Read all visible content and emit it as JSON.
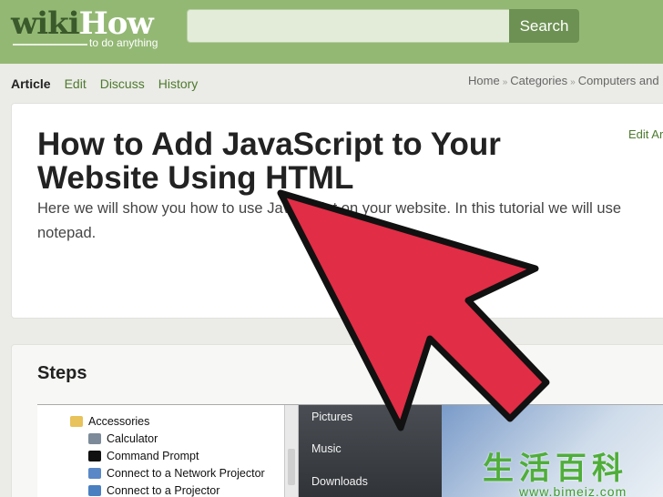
{
  "brand": {
    "wiki": "wiki",
    "how": "How",
    "tagline": "to do anything"
  },
  "search": {
    "placeholder": "",
    "button_label": "Search"
  },
  "tabs": [
    {
      "label": "Article",
      "active": true
    },
    {
      "label": "Edit"
    },
    {
      "label": "Discuss"
    },
    {
      "label": "History"
    }
  ],
  "breadcrumb": [
    "Home",
    "Categories",
    "Computers and E"
  ],
  "article": {
    "edit_link": "Edit Ar",
    "title": "How to Add JavaScript to Your Website Using HTML",
    "intro": "Here we will show you how to use JavaScript on your website. In this tutorial we will use notepad."
  },
  "steps": {
    "heading": "Steps",
    "menu_items": [
      "Accessories",
      "Calculator",
      "Command Prompt",
      "Connect to a Network Projector",
      "Connect to a Projector"
    ],
    "start_items": [
      "Pictures",
      "Music",
      "Downloads"
    ]
  },
  "watermark": {
    "chars": "生活百科",
    "url": "www.bimeiz.com"
  },
  "colors": {
    "header": "#93b874",
    "link": "#4e7a2e",
    "arrow": "#e12d45"
  }
}
